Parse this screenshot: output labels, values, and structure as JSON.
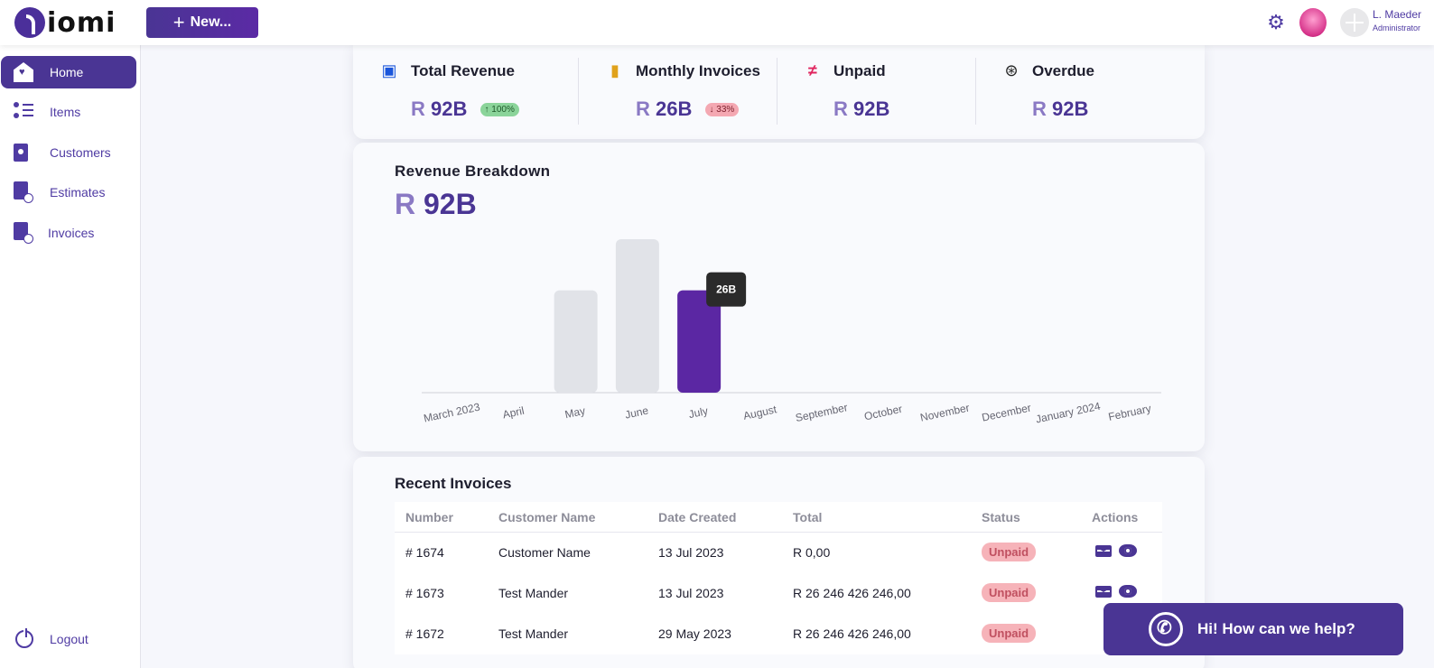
{
  "app": {
    "logo_text": "iomi"
  },
  "header": {
    "new_button": "New...",
    "user_name": "L. Maeder",
    "user_role": "Administrator"
  },
  "sidebar": {
    "items": [
      {
        "label": "Home",
        "icon": "home-icon",
        "active": true
      },
      {
        "label": "Items",
        "icon": "list-icon"
      },
      {
        "label": "Customers",
        "icon": "customers-icon"
      },
      {
        "label": "Estimates",
        "icon": "estimate-icon"
      },
      {
        "label": "Invoices",
        "icon": "invoice-icon"
      }
    ],
    "logout": "Logout"
  },
  "stats": [
    {
      "title": "Total Revenue",
      "currency": "R",
      "value": "92B",
      "badge": "100%",
      "badge_dir": "up",
      "icon": "money-icon",
      "icon_color": "#1a56db"
    },
    {
      "title": "Monthly Invoices",
      "currency": "R",
      "value": "26B",
      "badge": "33%",
      "badge_dir": "down",
      "icon": "document-icon",
      "icon_color": "#e0a21b"
    },
    {
      "title": "Unpaid",
      "currency": "R",
      "value": "92B",
      "icon": "not-equal-icon",
      "icon_color": "#e0245e"
    },
    {
      "title": "Overdue",
      "currency": "R",
      "value": "92B",
      "icon": "lifebuoy-icon",
      "icon_color": "#222222"
    }
  ],
  "breakdown": {
    "title": "Revenue Breakdown",
    "currency": "R",
    "total": "92B"
  },
  "chart_data": {
    "type": "bar",
    "categories": [
      "March 2023",
      "April",
      "May",
      "June",
      "July",
      "August",
      "September",
      "October",
      "November",
      "December",
      "January 2024",
      "February"
    ],
    "values": [
      0,
      0,
      26,
      39,
      26,
      0,
      0,
      0,
      0,
      0,
      0,
      0
    ],
    "highlight_index": 4,
    "tooltip": "26B",
    "colors": {
      "bar": "#e1e3e8",
      "highlight": "#5b27a3"
    },
    "grid": false
  },
  "recent": {
    "title": "Recent Invoices",
    "columns": [
      "Number",
      "Customer Name",
      "Date Created",
      "Total",
      "Status",
      "Actions"
    ],
    "rows": [
      {
        "number": "# 1674",
        "customer": "Customer Name",
        "date": "13 Jul 2023",
        "total": "R 0,00",
        "status": "Unpaid"
      },
      {
        "number": "# 1673",
        "customer": "Test Mander",
        "date": "13 Jul 2023",
        "total": "R 26 246 426 246,00",
        "status": "Unpaid"
      },
      {
        "number": "# 1672",
        "customer": "Test Mander",
        "date": "29 May 2023",
        "total": "R 26 246 426 246,00",
        "status": "Unpaid"
      }
    ]
  },
  "chat": {
    "label": "Hi! How can we help?"
  },
  "colors": {
    "accent": "#4a3594",
    "status_unpaid": "#f6b3b9"
  }
}
